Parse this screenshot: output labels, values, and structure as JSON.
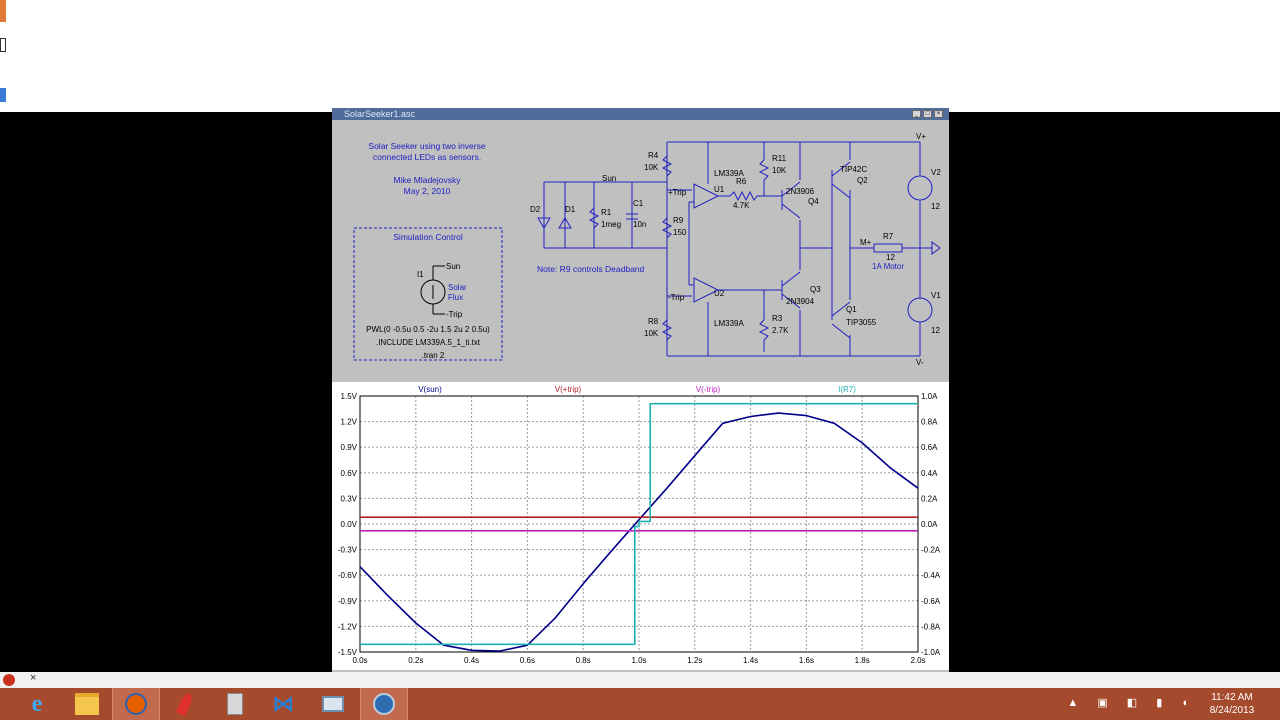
{
  "window": {
    "title": "SolarSeeker1.asc"
  },
  "schematic": {
    "description": [
      "Solar Seeker using two inverse",
      "connected LEDs as sensors."
    ],
    "author": "Mike Mladejovsky",
    "date": "May 2, 2010",
    "sim_control_title": "Simulation Control",
    "sim_sun": "Sun",
    "sim_source": "I1",
    "sim_solar": "Solar",
    "sim_flux": "Flux",
    "sim_trip": "-Trip",
    "pwl": "PWL(0 -0.5u 0.5 -2u 1.5 2u 2 0.5u)",
    "include": ".INCLUDE LM339A.5_1_ti.txt",
    "tran": ".tran 2",
    "note": "Note: R9 controls Deadband",
    "net_sun": "Sun",
    "net_ptrip": "+Trip",
    "net_mtrip": "-Trip",
    "net_vplus": "V+",
    "net_vminus": "V-",
    "net_mplus": "M+",
    "components": {
      "d2": "D2",
      "d1": "D1",
      "r1": "R1",
      "r1v": "1meg",
      "c1": "C1",
      "c1v": "10n",
      "r4": "R4",
      "r4v": "10K",
      "r9": "R9",
      "r9v": "150",
      "r8": "R8",
      "r8v": "10K",
      "u1": "U1",
      "u1m": "LM339A",
      "u2": "U2",
      "u2m": "LM339A",
      "r6": "R6",
      "r6v": "4.7K",
      "r11": "R11",
      "r11v": "10K",
      "r3": "R3",
      "r3v": "2.7K",
      "q4": "Q4",
      "q4m": "2N3906",
      "q3": "Q3",
      "q3m": "2N3904",
      "q2": "Q2",
      "q2m": "TIP42C",
      "q1": "Q1",
      "q1m": "TIP3055",
      "r7": "R7",
      "r7v": "12",
      "motor": "1A Motor",
      "v2": "V2",
      "v2v": "12",
      "v1": "V1",
      "v1v": "12"
    }
  },
  "plot": {
    "legend": [
      "V(sun)",
      "V(+trip)",
      "V(-trip)",
      "I(R7)"
    ],
    "legend_colors": [
      "#00008b",
      "#b22222",
      "#c020c0",
      "#20b0b0"
    ],
    "y_left_ticks": [
      "1.5V",
      "1.2V",
      "0.9V",
      "0.6V",
      "0.3V",
      "0.0V",
      "-0.3V",
      "-0.6V",
      "-0.9V",
      "-1.2V",
      "-1.5V"
    ],
    "y_right_ticks": [
      "1.0A",
      "0.8A",
      "0.6A",
      "0.4A",
      "0.2A",
      "0.0A",
      "-0.2A",
      "-0.4A",
      "-0.6A",
      "-0.8A",
      "-1.0A"
    ],
    "x_ticks": [
      "0.0s",
      "0.2s",
      "0.4s",
      "0.6s",
      "0.8s",
      "1.0s",
      "1.2s",
      "1.4s",
      "1.6s",
      "1.8s",
      "2.0s"
    ]
  },
  "chart_data": {
    "type": "line",
    "xlim": [
      0,
      2
    ],
    "ylim_left": [
      -1.5,
      1.5
    ],
    "ylim_right": [
      -1.0,
      1.0
    ],
    "grid": true,
    "legend_placement": "top",
    "series": [
      {
        "name": "V(sun)",
        "axis": "left",
        "color": "#00008b",
        "x": [
          0,
          0.1,
          0.2,
          0.3,
          0.4,
          0.5,
          0.6,
          0.7,
          0.8,
          0.9,
          1.0,
          1.1,
          1.2,
          1.3,
          1.4,
          1.5,
          1.6,
          1.7,
          1.8,
          1.9,
          2.0
        ],
        "y": [
          -0.5,
          -0.84,
          -1.16,
          -1.42,
          -1.48,
          -1.49,
          -1.42,
          -1.1,
          -0.7,
          -0.32,
          0.05,
          0.42,
          0.8,
          1.18,
          1.26,
          1.3,
          1.27,
          1.18,
          0.95,
          0.66,
          0.42
        ]
      },
      {
        "name": "V(+trip)",
        "axis": "left",
        "color": "#b22222",
        "x": [
          0,
          2
        ],
        "y": [
          0.08,
          0.08
        ]
      },
      {
        "name": "V(-trip)",
        "axis": "left",
        "color": "#c020c0",
        "x": [
          0,
          2
        ],
        "y": [
          -0.08,
          -0.08
        ]
      },
      {
        "name": "I(R7)",
        "axis": "right",
        "color": "#20b0b0",
        "x": [
          0,
          0.985,
          0.985,
          1.0,
          1.0,
          1.04,
          1.04,
          2.0
        ],
        "y": [
          -0.94,
          -0.94,
          -0.02,
          -0.02,
          0.02,
          0.02,
          0.94,
          0.94
        ]
      }
    ]
  },
  "taskbar": {
    "time": "11:42 AM",
    "date": "8/24/2013",
    "addon_close": "×"
  }
}
